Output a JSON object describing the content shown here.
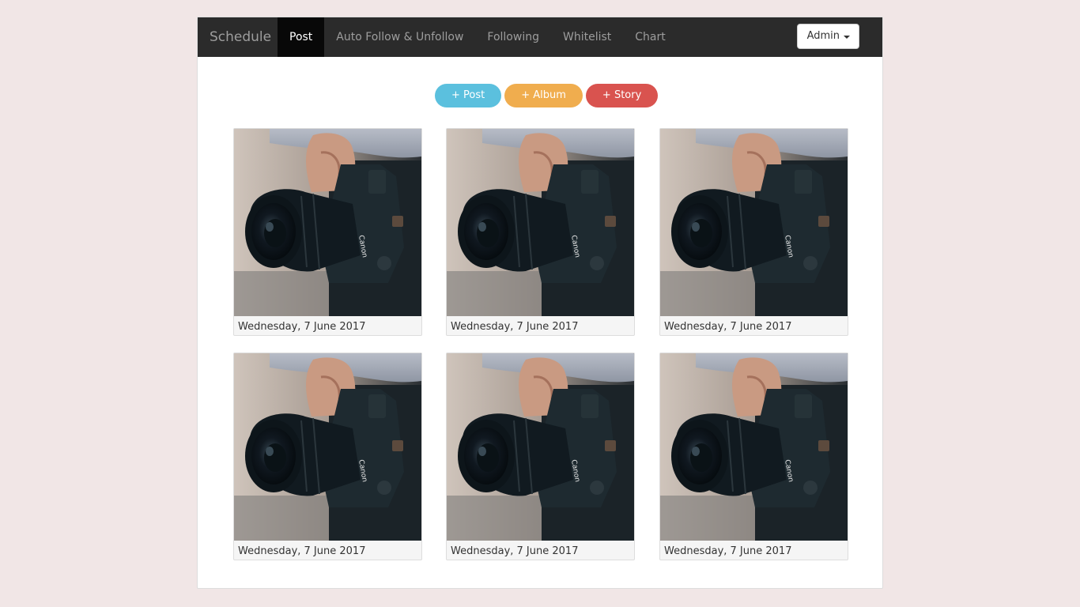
{
  "navbar": {
    "brand": "Schedule",
    "items": [
      {
        "label": "Post",
        "active": true
      },
      {
        "label": "Auto Follow & Unfollow",
        "active": false
      },
      {
        "label": "Following",
        "active": false
      },
      {
        "label": "Whitelist",
        "active": false
      },
      {
        "label": "Chart",
        "active": false
      }
    ],
    "user_menu_label": "Admin"
  },
  "actions": {
    "post_label": "+ Post",
    "album_label": "+ Album",
    "story_label": "+ Story"
  },
  "colors": {
    "navbar_bg": "#2b2b2b",
    "post_btn": "#5bc0de",
    "album_btn": "#f0ad4e",
    "story_btn": "#d9534f",
    "page_bg": "#f1e6e6"
  },
  "posts": [
    {
      "date": "Wednesday, 7 June 2017"
    },
    {
      "date": "Wednesday, 7 June 2017"
    },
    {
      "date": "Wednesday, 7 June 2017"
    },
    {
      "date": "Wednesday, 7 June 2017"
    },
    {
      "date": "Wednesday, 7 June 2017"
    },
    {
      "date": "Wednesday, 7 June 2017"
    }
  ]
}
